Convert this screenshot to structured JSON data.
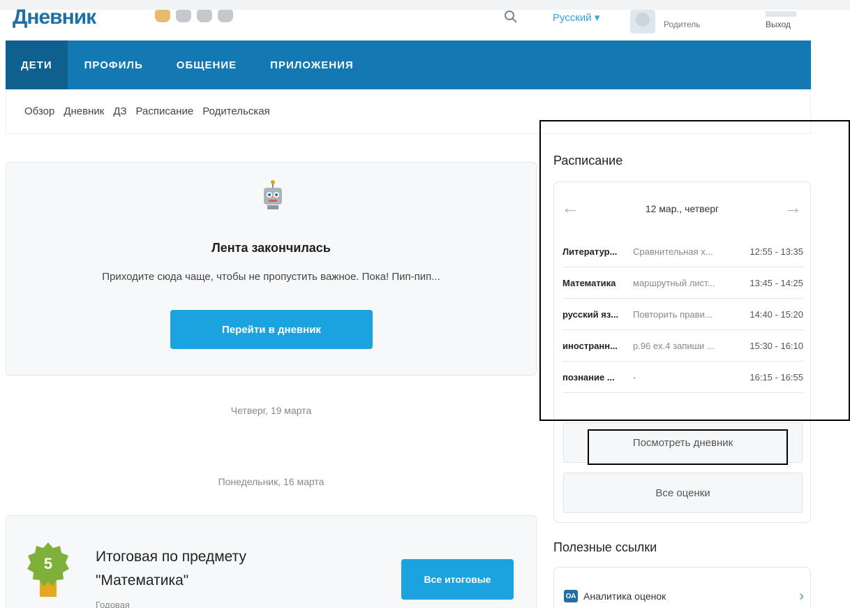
{
  "header": {
    "logo": "Дневник",
    "language": "Русский ▾",
    "role": "Родитель",
    "logout": "Выход"
  },
  "main_nav": [
    "ДЕТИ",
    "ПРОФИЛЬ",
    "ОБЩЕНИЕ",
    "ПРИЛОЖЕНИЯ"
  ],
  "sub_nav": [
    "Обзор",
    "Дневник",
    "ДЗ",
    "Расписание",
    "Родительская"
  ],
  "feed": {
    "title": "Лента закончилась",
    "text": "Приходите сюда чаще, чтобы не пропустить важное. Пока! Пип-пип...",
    "button": "Перейти в дневник"
  },
  "dates": [
    "Четверг, 19 марта",
    "Понедельник, 16 марта"
  ],
  "grade_card": {
    "grade": "5",
    "title_line1": "Итоговая по предмету",
    "title_line2": "\"Математика\"",
    "subtitle": "Годовая",
    "button": "Все итоговые"
  },
  "schedule": {
    "heading": "Расписание",
    "date": "12 мар., четверг",
    "prev_arrow": "←",
    "next_arrow": "→",
    "lessons": [
      {
        "subject": "Литератур...",
        "homework": "Сравнительная х...",
        "time": "12:55 - 13:35"
      },
      {
        "subject": "Математика",
        "homework": "маршрутный лист...",
        "time": "13:45 - 14:25"
      },
      {
        "subject": "русский яз...",
        "homework": "Повторить прави...",
        "time": "14:40 - 15:20"
      },
      {
        "subject": "иностранн...",
        "homework": "р.96 ex.4 запиши ...",
        "time": "15:30 - 16:10"
      },
      {
        "subject": "познание ...",
        "homework": "-",
        "time": "16:15 - 16:55"
      }
    ],
    "view_diary_button": "Посмотреть дневник",
    "all_grades_button": "Все оценки"
  },
  "links": {
    "heading": "Полезные ссылки",
    "items": [
      {
        "label": "Аналитика оценок",
        "icon_text": "ОА",
        "chevron": "›"
      }
    ]
  },
  "colors": {
    "nav_blue": "#1479b2",
    "nav_active": "#0f5f8f",
    "button_blue": "#1aa3de",
    "grade_green": "#7fb03a",
    "grade_gold": "#e6a81e"
  }
}
